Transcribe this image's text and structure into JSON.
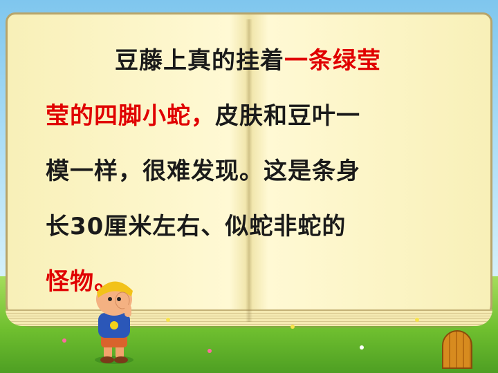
{
  "story": {
    "line1": {
      "indent": "",
      "black": "豆藤上真的挂着",
      "red": "一条绿莹"
    },
    "line2": {
      "red": "莹的四脚小蛇，",
      "black": "皮肤和豆叶一"
    },
    "line3": {
      "black": "模一样，很难发现。这是条身"
    },
    "line4": {
      "black": "长30厘米左右、似蛇非蛇的"
    },
    "line5": {
      "red": "怪物。"
    }
  },
  "colors": {
    "highlight": "#e00000",
    "text": "#1a1a1a",
    "paper": "#fff9d4"
  },
  "icons": [
    "child-cartoon-icon",
    "door-icon",
    "flower-icon"
  ]
}
